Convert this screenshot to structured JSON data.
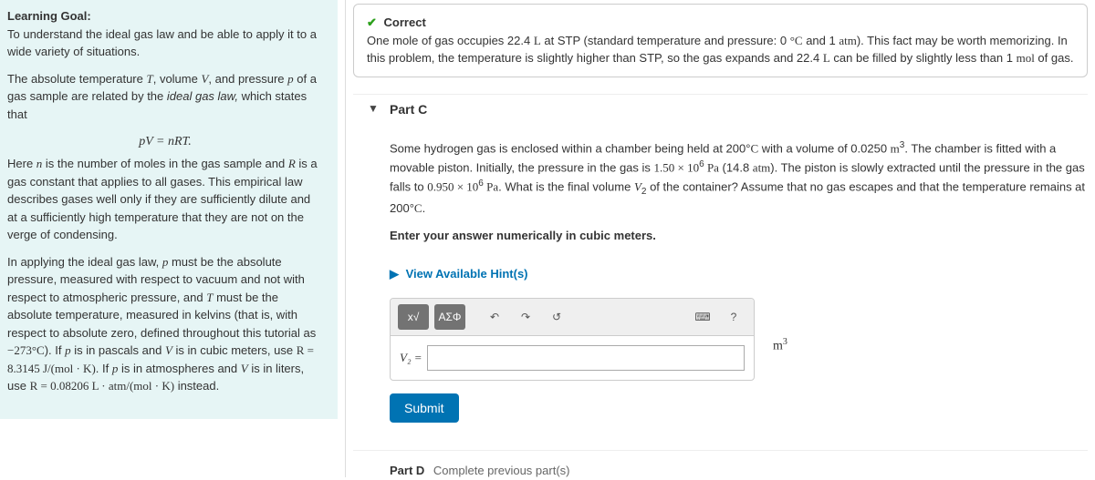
{
  "left": {
    "lg_label": "Learning Goal:",
    "lg_text": "To understand the ideal gas law and be able to apply it to a wide variety of situations.",
    "para1_a": "The absolute temperature ",
    "para1_b": ", volume ",
    "para1_c": ", and pressure ",
    "para1_d": " of a gas sample are related by the ",
    "para1_e": "ideal gas law,",
    "para1_f": " which states that",
    "equation": "pV = nRT.",
    "para2_a": "Here ",
    "para2_b": " is the number of moles in the gas sample and ",
    "para2_c": " is a gas constant that applies to all gases. This empirical law describes gases well only if they are sufficiently dilute and at a sufficiently high temperature that they are not on the verge of condensing.",
    "para3_a": "In applying the ideal gas law, ",
    "para3_b": " must be the absolute pressure, measured with respect to vacuum and not with respect to atmospheric pressure, and ",
    "para3_c": " must be the absolute temperature, measured in kelvins (that is, with respect to absolute zero, defined throughout this tutorial as ",
    "para3_neg273": "−273°C",
    "para3_d": "). If ",
    "para3_e": " is in pascals and ",
    "para3_f": " is in cubic meters, use ",
    "para3_R1": "R = 8.3145 J/(mol · K)",
    "para3_g": ". If ",
    "para3_h": " is in atmospheres and ",
    "para3_i": " is in liters, use ",
    "para3_R2": "R = 0.08206 L · atm/(mol · K)",
    "para3_j": " instead.",
    "T": "T",
    "V": "V",
    "p": "p",
    "n": "n",
    "R": "R"
  },
  "feedback": {
    "title": "Correct",
    "body_a": "One mole of gas occupies 22.4 ",
    "body_L": "L",
    "body_b": " at STP (standard temperature and pressure: 0 ",
    "body_degC": "°C",
    "body_c": " and 1 ",
    "body_atm": "atm",
    "body_d": "). This fact may be worth memorizing. In this problem, the temperature is slightly higher than STP, so the gas expands and 22.4 ",
    "body_e": " can be filled by slightly less than 1 ",
    "body_mol": "mol",
    "body_f": " of gas."
  },
  "partC": {
    "label": "Part C",
    "q_a": "Some hydrogen gas is enclosed within a chamber being held at 200°",
    "q_C": "C",
    "q_b": " with a volume of 0.0250 ",
    "q_m3": "m",
    "q_c": ". The chamber is fitted with a movable piston. Initially, the pressure in the gas is ",
    "q_p1": "1.50 × 10",
    "q_p1exp": "6",
    "q_Pa": " Pa",
    "q_d": " (14.8 ",
    "q_atm": "atm",
    "q_e": "). The piston is slowly extracted until the pressure in the gas falls to ",
    "q_p2": "0.950 × 10",
    "q_p2exp": "6",
    "q_f": ". What is the final volume ",
    "q_V2": "V",
    "q_g": " of the container? Assume that no gas escapes and that the temperature remains at 200°",
    "q_h": ".",
    "instruction": "Enter your answer numerically in cubic meters.",
    "hints": "View Available Hint(s)",
    "var_label": "V₂ =",
    "unit_base": "m",
    "unit_exp": "3",
    "input_value": "",
    "submit": "Submit",
    "toolbar": {
      "templates": "x√",
      "greek": "ΑΣΦ",
      "undo": "↶",
      "redo": "↷",
      "reset": "↺",
      "keyboard": "⌨",
      "help": "?"
    }
  },
  "partD": {
    "label": "Part D",
    "status": "Complete previous part(s)"
  }
}
